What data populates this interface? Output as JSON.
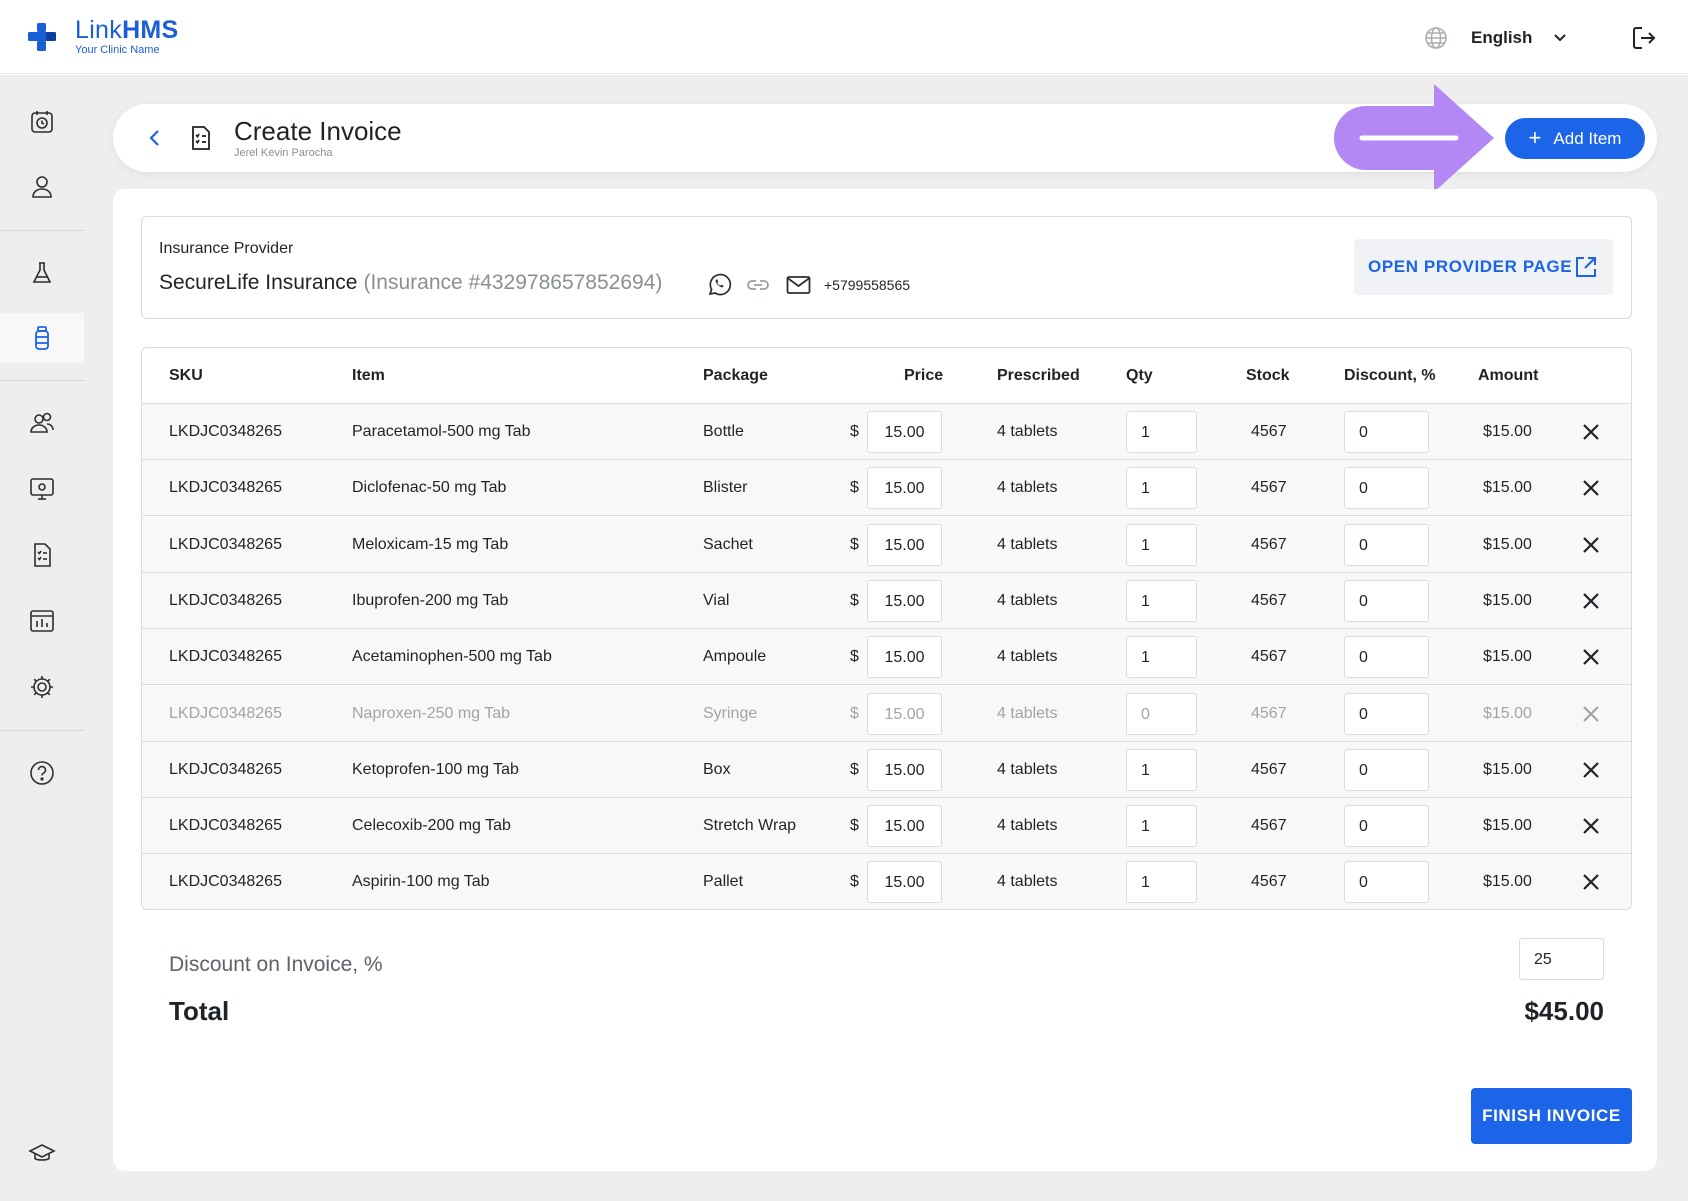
{
  "app": {
    "brand_light": "Link",
    "brand_bold": "HMS",
    "clinic_name": "Your Clinic Name",
    "language": "English",
    "accent_color": "#1c64e8"
  },
  "sidebar": {
    "items": [
      {
        "icon": "clock-calendar-icon",
        "active": false
      },
      {
        "icon": "user-icon",
        "active": false
      },
      {
        "icon": "lab-flask-icon",
        "active": false
      },
      {
        "icon": "medicine-bottle-icon",
        "active": true
      },
      {
        "icon": "users-group-icon",
        "active": false
      },
      {
        "icon": "monitor-settings-icon",
        "active": false
      },
      {
        "icon": "invoice-document-icon",
        "active": false
      },
      {
        "icon": "reports-chart-icon",
        "active": false
      },
      {
        "icon": "gear-icon",
        "active": false
      },
      {
        "icon": "help-icon",
        "active": false
      },
      {
        "icon": "graduation-cap-icon",
        "active": false
      }
    ]
  },
  "header": {
    "title": "Create Invoice",
    "subtitle": "Jerel Kevin Parocha",
    "add_item_label": "Add Item"
  },
  "provider": {
    "label": "Insurance Provider",
    "name": "SecureLife Insurance",
    "insurance_number": "(Insurance #432978657852694)",
    "phone": "+5799558565",
    "open_button_label": "OPEN PROVIDER PAGE"
  },
  "table": {
    "columns": [
      "SKU",
      "Item",
      "Package",
      "Price",
      "Prescribed",
      "Qty",
      "Stock",
      "Discount, %",
      "Amount"
    ],
    "currency_symbol": "$",
    "rows": [
      {
        "sku": "LKDJC0348265",
        "item": "Paracetamol-500 mg Tab",
        "package": "Bottle",
        "price": "15.00",
        "prescribed": "4 tablets",
        "qty": "1",
        "stock": "4567",
        "discount": "0",
        "amount": "$15.00",
        "disabled": false
      },
      {
        "sku": "LKDJC0348265",
        "item": "Diclofenac-50 mg Tab",
        "package": "Blister",
        "price": "15.00",
        "prescribed": "4 tablets",
        "qty": "1",
        "stock": "4567",
        "discount": "0",
        "amount": "$15.00",
        "disabled": false
      },
      {
        "sku": "LKDJC0348265",
        "item": "Meloxicam-15 mg Tab",
        "package": "Sachet",
        "price": "15.00",
        "prescribed": "4 tablets",
        "qty": "1",
        "stock": "4567",
        "discount": "0",
        "amount": "$15.00",
        "disabled": false
      },
      {
        "sku": "LKDJC0348265",
        "item": "Ibuprofen-200 mg Tab",
        "package": "Vial",
        "price": "15.00",
        "prescribed": "4 tablets",
        "qty": "1",
        "stock": "4567",
        "discount": "0",
        "amount": "$15.00",
        "disabled": false
      },
      {
        "sku": "LKDJC0348265",
        "item": "Acetaminophen-500 mg Tab",
        "package": "Ampoule",
        "price": "15.00",
        "prescribed": "4 tablets",
        "qty": "1",
        "stock": "4567",
        "discount": "0",
        "amount": "$15.00",
        "disabled": false
      },
      {
        "sku": "LKDJC0348265",
        "item": "Naproxen-250 mg Tab",
        "package": "Syringe",
        "price": "15.00",
        "prescribed": "4 tablets",
        "qty": "0",
        "stock": "4567",
        "discount": "0",
        "amount": "$15.00",
        "disabled": true
      },
      {
        "sku": "LKDJC0348265",
        "item": "Ketoprofen-100 mg Tab",
        "package": "Box",
        "price": "15.00",
        "prescribed": "4 tablets",
        "qty": "1",
        "stock": "4567",
        "discount": "0",
        "amount": "$15.00",
        "disabled": false
      },
      {
        "sku": "LKDJC0348265",
        "item": "Celecoxib-200 mg Tab",
        "package": "Stretch Wrap",
        "price": "15.00",
        "prescribed": "4 tablets",
        "qty": "1",
        "stock": "4567",
        "discount": "0",
        "amount": "$15.00",
        "disabled": false
      },
      {
        "sku": "LKDJC0348265",
        "item": "Aspirin-100 mg Tab",
        "package": "Pallet",
        "price": "15.00",
        "prescribed": "4 tablets",
        "qty": "1",
        "stock": "4567",
        "discount": "0",
        "amount": "$15.00",
        "disabled": false
      }
    ]
  },
  "summary": {
    "discount_label": "Discount on Invoice, %",
    "discount_value": "25",
    "total_label": "Total",
    "total_value": "$45.00"
  },
  "footer": {
    "finish_label": "FINISH INVOICE"
  }
}
